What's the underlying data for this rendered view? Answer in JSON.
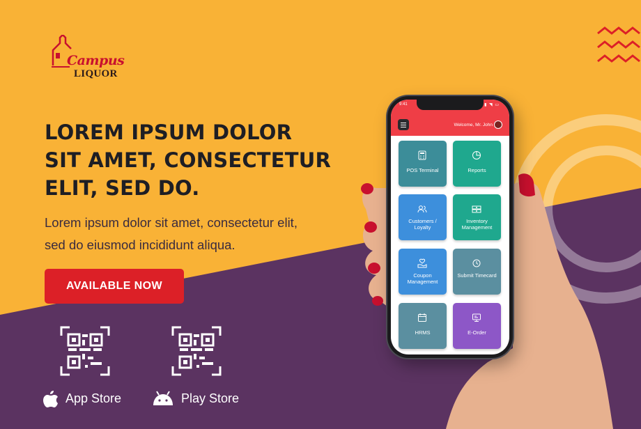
{
  "colors": {
    "yellow": "#f9b236",
    "purple": "#5b3361",
    "accent": "#dc2027",
    "zigzag": "#dc2027"
  },
  "logo": {
    "line1": "Campus",
    "line2": "LIQUOR"
  },
  "headline": {
    "line1": "LOREM IPSUM DOLOR",
    "line2": "SIT AMET, CONSECTETUR",
    "line3": "ELIT, SED DO."
  },
  "subtext": {
    "line1": "Lorem ipsum dolor sit amet, consectetur elit,",
    "line2": "sed do eiusmod incididunt aliqua."
  },
  "cta": {
    "label": "AVAILABLE NOW"
  },
  "stores": {
    "app": {
      "label": "App Store",
      "icon": "apple-icon"
    },
    "play": {
      "label": "Play Store",
      "icon": "android-icon"
    }
  },
  "phone": {
    "status_time": "9:41",
    "welcome": "Welcome, Mr. John",
    "tiles": [
      {
        "label": "POS Terminal",
        "icon": "calculator-icon",
        "color": "#3c8d99"
      },
      {
        "label": "Reports",
        "icon": "pie-chart-icon",
        "color": "#1fa88e"
      },
      {
        "label": "Customers / Loyalty",
        "icon": "users-icon",
        "color": "#3d8fdc"
      },
      {
        "label": "Inventory Management",
        "icon": "inventory-icon",
        "color": "#1fa88e"
      },
      {
        "label": "Coupon Management",
        "icon": "coupon-icon",
        "color": "#3d8fdc"
      },
      {
        "label": "Submit Timecard",
        "icon": "timecard-icon",
        "color": "#5b8fa0"
      },
      {
        "label": "HRMS",
        "icon": "calendar-icon",
        "color": "#5b8fa0"
      },
      {
        "label": "E-Order",
        "icon": "e-order-icon",
        "color": "#8d57c7"
      }
    ]
  }
}
